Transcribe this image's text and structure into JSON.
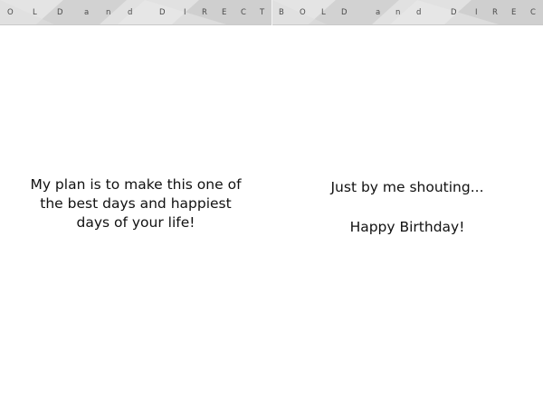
{
  "banner": {
    "left_letters": [
      "O",
      "L",
      "D",
      "a",
      "n",
      "d",
      "D",
      "I",
      "R",
      "E",
      "C",
      "T"
    ],
    "right_letters": [
      "B",
      "O",
      "L",
      "D",
      "a",
      "n",
      "d",
      "D",
      "I",
      "R",
      "E",
      "C"
    ]
  },
  "left_panel": {
    "lines": [
      "My plan is to make this one of",
      "the best days and happiest",
      "days of your life!"
    ]
  },
  "right_panel": {
    "line1": "Just by me shouting...",
    "line2": "Happy Birthday!"
  },
  "colors": {
    "banner_background": "#d9d9d9",
    "banner_text": "#4a4a4a",
    "text": "#111111",
    "page": "#ffffff"
  }
}
